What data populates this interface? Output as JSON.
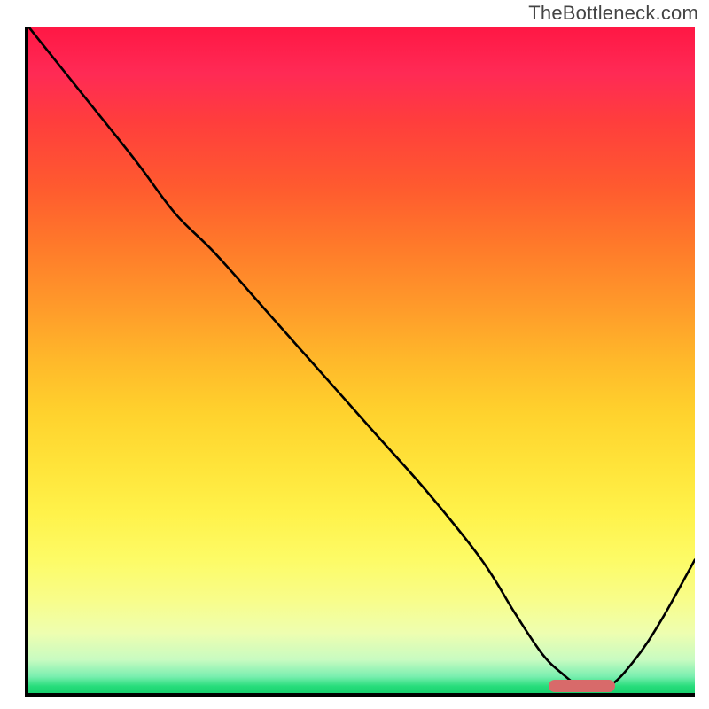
{
  "watermark": "TheBottleneck.com",
  "chart_data": {
    "type": "line",
    "title": "",
    "xlabel": "",
    "ylabel": "",
    "xlim": [
      0,
      100
    ],
    "ylim": [
      0,
      100
    ],
    "grid": false,
    "legend": false,
    "background": "heatmap-gradient-red-yellow-green",
    "series": [
      {
        "name": "bottleneck-curve",
        "x": [
          0,
          8,
          16,
          22,
          28,
          36,
          44,
          52,
          60,
          68,
          73,
          77,
          80,
          83,
          87,
          91,
          95,
          100
        ],
        "y": [
          100,
          90,
          80,
          72,
          66,
          57,
          48,
          39,
          30,
          20,
          12,
          6,
          3,
          1,
          1,
          5,
          11,
          20
        ]
      }
    ],
    "optimal_marker": {
      "x_start": 78,
      "x_end": 88,
      "y": 1,
      "color": "#d86a6a"
    }
  }
}
